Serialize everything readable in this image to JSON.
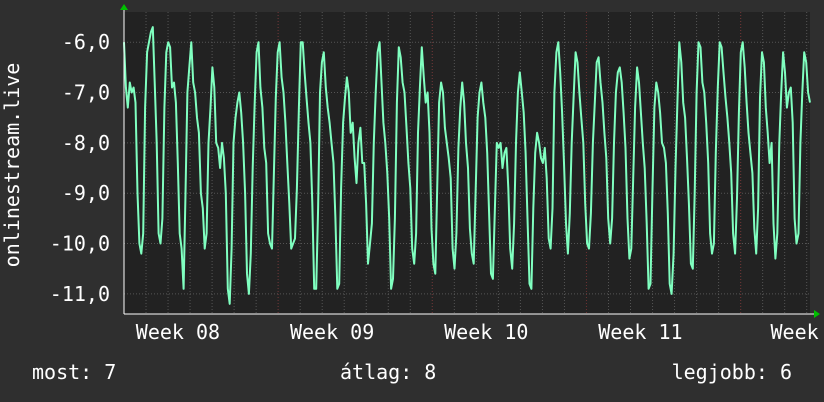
{
  "chart_data": {
    "type": "line",
    "ylabel": "onlinestream.live",
    "ylim": [
      -11.4,
      -5.4
    ],
    "y_ticks": [
      -11.0,
      -10.0,
      -9.0,
      -8.0,
      -7.0,
      -6.0
    ],
    "y_tick_labels": [
      "-11,0",
      "-10,0",
      "-9,0",
      "-8,0",
      "-7,0",
      "-6,0"
    ],
    "x_range": [
      0,
      4.45
    ],
    "x_ticks": [
      0.35,
      1.35,
      2.35,
      3.35,
      4.35
    ],
    "x_tick_labels": [
      "Week 08",
      "Week 09",
      "Week 10",
      "Week 11",
      "Week"
    ],
    "grid": true,
    "colors": {
      "line": "#80ffc0",
      "background": "#222222",
      "grid": "#555555",
      "vgrid": "#6a2f2f",
      "arrow": "#00c000"
    },
    "series": [
      {
        "values": [
          -6.0,
          -6.9,
          -7.3,
          -6.8,
          -7.0,
          -6.9,
          -7.2,
          -9.0,
          -10.0,
          -10.2,
          -9.8,
          -7.3,
          -6.2,
          -6.0,
          -5.8,
          -5.7,
          -6.8,
          -8.0,
          -9.8,
          -10.0,
          -9.5,
          -7.3,
          -6.2,
          -6.0,
          -6.1,
          -6.9,
          -6.8,
          -7.2,
          -8.4,
          -9.8,
          -10.1,
          -10.9,
          -9.0,
          -7.0,
          -6.5,
          -6.0,
          -6.8,
          -7.0,
          -7.5,
          -7.8,
          -9.0,
          -9.3,
          -10.1,
          -9.8,
          -8.0,
          -7.3,
          -6.5,
          -6.9,
          -8.0,
          -8.1,
          -8.5,
          -8.0,
          -8.3,
          -9.0,
          -10.9,
          -11.2,
          -10.1,
          -8.0,
          -7.5,
          -7.2,
          -7.0,
          -7.4,
          -8.0,
          -9.0,
          -10.6,
          -11.0,
          -10.2,
          -8.5,
          -7.2,
          -6.2,
          -6.0,
          -6.9,
          -7.3,
          -8.1,
          -8.4,
          -9.8,
          -10.0,
          -10.1,
          -8.6,
          -7.1,
          -6.2,
          -6.0,
          -6.7,
          -7.0,
          -7.6,
          -8.4,
          -9.2,
          -10.1,
          -10.0,
          -9.9,
          -8.9,
          -7.3,
          -6.0,
          -6.0,
          -6.6,
          -7.1,
          -7.6,
          -8.0,
          -9.2,
          -10.9,
          -10.9,
          -9.3,
          -7.0,
          -6.4,
          -6.2,
          -6.9,
          -7.3,
          -7.6,
          -8.0,
          -8.4,
          -9.5,
          -10.9,
          -10.8,
          -8.9,
          -7.6,
          -7.1,
          -6.7,
          -7.0,
          -7.8,
          -7.6,
          -8.3,
          -8.8,
          -8.0,
          -7.7,
          -8.4,
          -8.4,
          -9.2,
          -10.4,
          -10.0,
          -9.6,
          -8.0,
          -7.0,
          -6.2,
          -6.0,
          -6.8,
          -7.6,
          -8.0,
          -8.6,
          -9.5,
          -10.9,
          -10.7,
          -9.5,
          -7.2,
          -6.1,
          -6.3,
          -6.8,
          -7.0,
          -7.7,
          -8.4,
          -8.9,
          -10.1,
          -10.4,
          -9.8,
          -7.8,
          -6.9,
          -6.1,
          -6.7,
          -7.2,
          -7.0,
          -7.8,
          -9.7,
          -10.4,
          -10.6,
          -8.9,
          -7.2,
          -6.8,
          -7.0,
          -7.7,
          -8.0,
          -8.3,
          -8.7,
          -10.1,
          -10.5,
          -9.8,
          -8.1,
          -7.3,
          -6.8,
          -7.2,
          -8.0,
          -8.5,
          -9.7,
          -10.2,
          -10.4,
          -9.0,
          -7.5,
          -7.0,
          -6.8,
          -7.2,
          -7.5,
          -8.2,
          -9.4,
          -10.6,
          -10.7,
          -9.3,
          -8.0,
          -8.1,
          -8.0,
          -8.5,
          -8.2,
          -8.1,
          -8.9,
          -10.1,
          -10.5,
          -9.6,
          -8.0,
          -7.0,
          -6.6,
          -7.0,
          -7.4,
          -8.2,
          -9.5,
          -10.8,
          -10.9,
          -9.3,
          -8.2,
          -7.8,
          -8.0,
          -8.3,
          -8.4,
          -8.1,
          -8.7,
          -9.9,
          -10.1,
          -9.3,
          -7.0,
          -6.2,
          -6.0,
          -6.6,
          -7.4,
          -8.4,
          -9.6,
          -10.2,
          -9.4,
          -8.0,
          -7.1,
          -6.2,
          -6.4,
          -7.0,
          -7.5,
          -8.0,
          -9.2,
          -10.0,
          -10.1,
          -9.4,
          -8.0,
          -7.2,
          -6.4,
          -6.3,
          -6.8,
          -7.2,
          -7.8,
          -8.3,
          -9.5,
          -10.0,
          -9.5,
          -8.0,
          -7.0,
          -6.6,
          -6.5,
          -6.8,
          -7.4,
          -8.1,
          -9.5,
          -10.3,
          -10.1,
          -8.7,
          -7.3,
          -6.5,
          -6.8,
          -7.4,
          -8.0,
          -8.5,
          -9.6,
          -10.9,
          -10.8,
          -9.0,
          -7.3,
          -6.8,
          -7.0,
          -7.4,
          -8.0,
          -8.1,
          -8.4,
          -9.4,
          -10.8,
          -11.0,
          -10.2,
          -8.5,
          -7.2,
          -6.0,
          -6.4,
          -7.2,
          -7.5,
          -8.3,
          -9.2,
          -10.4,
          -10.5,
          -9.0,
          -7.0,
          -6.0,
          -6.1,
          -6.8,
          -7.0,
          -7.6,
          -8.4,
          -9.8,
          -10.2,
          -10.0,
          -8.2,
          -6.9,
          -6.0,
          -6.1,
          -6.6,
          -7.1,
          -7.5,
          -8.0,
          -8.6,
          -9.8,
          -10.2,
          -9.1,
          -7.4,
          -6.2,
          -6.0,
          -6.5,
          -7.2,
          -7.8,
          -8.2,
          -8.6,
          -9.7,
          -10.2,
          -9.3,
          -7.1,
          -6.2,
          -6.4,
          -7.3,
          -7.8,
          -8.4,
          -8.0,
          -9.6,
          -10.3,
          -9.8,
          -8.0,
          -7.0,
          -6.2,
          -6.6,
          -7.3,
          -7.0,
          -6.9,
          -7.6,
          -9.5,
          -10.0,
          -9.8,
          -8.0,
          -7.0,
          -6.2,
          -6.4,
          -7.0,
          -7.2
        ]
      }
    ]
  },
  "stats": {
    "now": "most: 7",
    "avg": "átlag: 8",
    "max": "legjobb: 6"
  }
}
